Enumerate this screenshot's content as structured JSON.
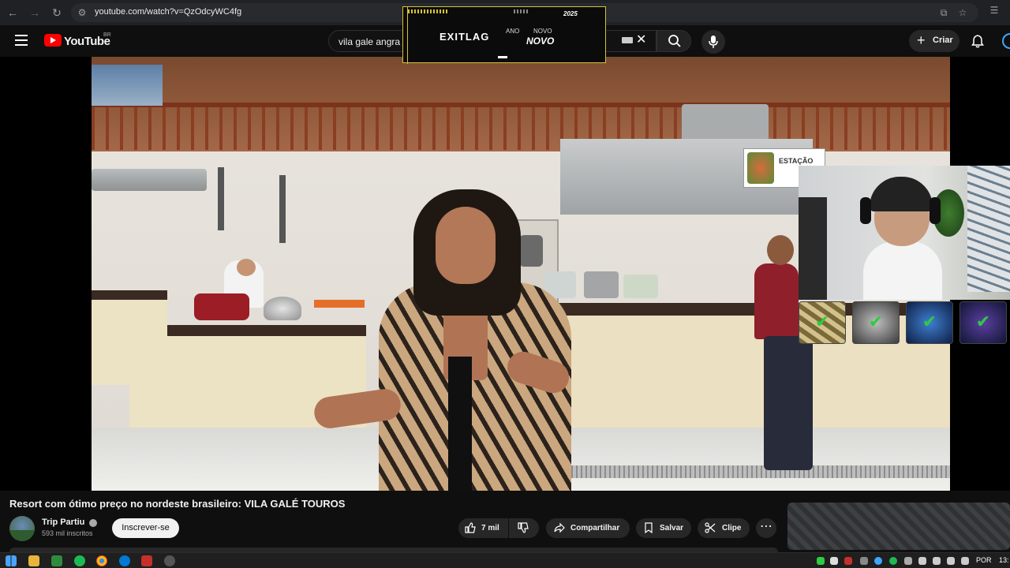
{
  "browser": {
    "url": "youtube.com/watch?v=QzOdcyWC4fg"
  },
  "header": {
    "brand": "YouTube",
    "country": "BR",
    "search_value": "vila gale angra",
    "create_label": "Criar"
  },
  "overlay": {
    "brand": "EXITLAG",
    "ano": "ANO",
    "novo": "NOVO",
    "novo_big": "NOVO",
    "year": "2025"
  },
  "video": {
    "title": "Resort com ótimo preço no nordeste brasileiro: VILA GALÉ TOUROS",
    "scene_sign": "ESTAÇÃO"
  },
  "channel": {
    "name": "Trip Partiu",
    "subscribers": "593 mil inscritos",
    "subscribe_label": "Inscrever-se"
  },
  "actions": {
    "likes": "7 mil",
    "share": "Compartilhar",
    "save": "Salvar",
    "clip": "Clipe"
  },
  "taskbar": {
    "lang": "POR",
    "clock": "13:"
  },
  "colors": {
    "accent": "#ff0000",
    "background": "#0f0f0f",
    "pill": "#272727",
    "check": "#2ecc40"
  }
}
